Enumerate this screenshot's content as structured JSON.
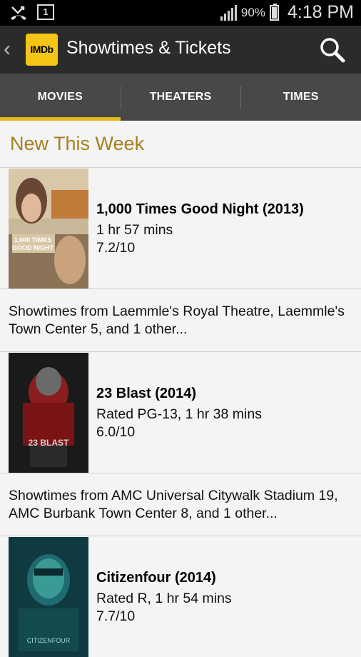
{
  "status_bar": {
    "battery_percent": "90%",
    "time": "4:18 PM",
    "icons": [
      "missed-call-icon",
      "notification-1-icon",
      "signal-icon",
      "battery-icon"
    ],
    "notification_count": "1"
  },
  "action_bar": {
    "logo_text": "IMDb",
    "title": "Showtimes & Tickets",
    "back_icon": "chevron-left-icon",
    "search_icon": "search-icon"
  },
  "tabs": [
    {
      "label": "MOVIES",
      "active": true
    },
    {
      "label": "THEATERS",
      "active": false
    },
    {
      "label": "TIMES",
      "active": false
    }
  ],
  "section_header": "New This Week",
  "movies": [
    {
      "title": "1,000 Times Good Night (2013)",
      "meta": "1 hr 57 mins",
      "rating": "7.2/10",
      "showtimes": "Showtimes from Laemmle's Royal Theatre, Laemmle's Town Center 5, and 1 other..."
    },
    {
      "title": "23 Blast (2014)",
      "meta": "Rated PG-13, 1 hr 38 mins",
      "rating": "6.0/10",
      "showtimes": "Showtimes from AMC Universal Citywalk Stadium 19, AMC Burbank Town Center 8, and 1 other..."
    },
    {
      "title": "Citizenfour (2014)",
      "meta": "Rated R, 1 hr 54 mins",
      "rating": "7.7/10"
    }
  ],
  "colors": {
    "accent": "#e2b818",
    "section_header": "#a77f1d",
    "logo_bg": "#f5c518",
    "action_bar": "#2b2b2b",
    "tab_bar": "#484848"
  }
}
